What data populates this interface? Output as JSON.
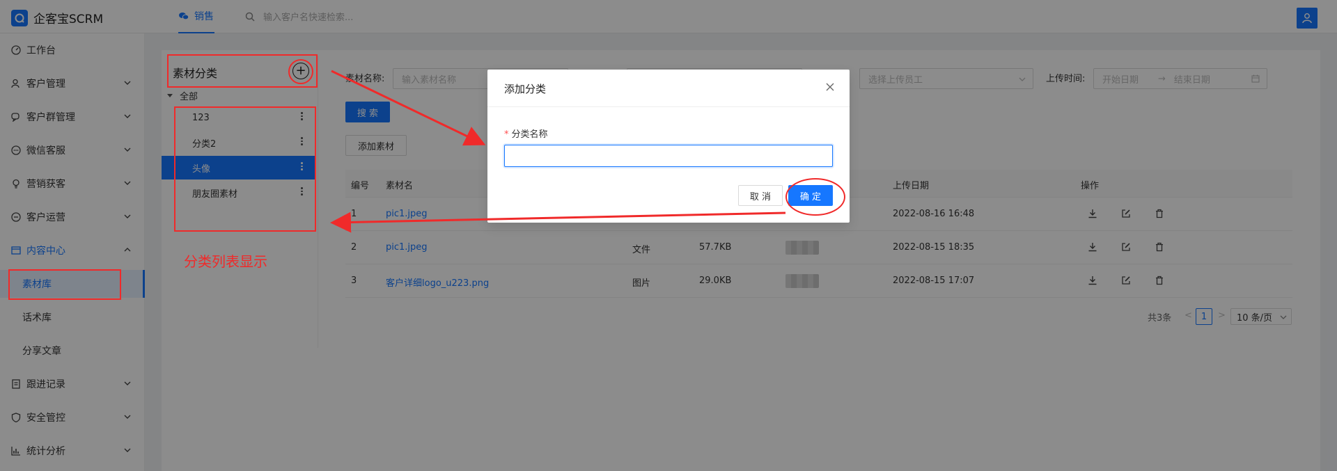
{
  "app": {
    "title": "企客宝SCRM"
  },
  "topbar": {
    "tab_label": "销售",
    "search_placeholder": "输入客户名快速检索..."
  },
  "sidebar": {
    "items": [
      {
        "label": "工作台",
        "icon": "dashboard-icon"
      },
      {
        "label": "客户管理",
        "icon": "user-icon"
      },
      {
        "label": "客户群管理",
        "icon": "group-chat-icon"
      },
      {
        "label": "微信客服",
        "icon": "chat-icon"
      },
      {
        "label": "营销获客",
        "icon": "bulb-icon"
      },
      {
        "label": "客户运营",
        "icon": "ops-icon"
      },
      {
        "label": "内容中心",
        "icon": "content-icon"
      },
      {
        "label": "跟进记录",
        "icon": "record-icon"
      },
      {
        "label": "安全管控",
        "icon": "shield-icon"
      },
      {
        "label": "统计分析",
        "icon": "chart-icon"
      }
    ],
    "sub_items": [
      {
        "label": "素材库"
      },
      {
        "label": "话术库"
      },
      {
        "label": "分享文章"
      }
    ]
  },
  "category": {
    "title": "素材分类",
    "add_symbol": "+",
    "root": "全部",
    "items": [
      {
        "label": "123"
      },
      {
        "label": "分类2"
      },
      {
        "label": "头像"
      },
      {
        "label": "朋友圈素材"
      }
    ]
  },
  "filters": {
    "name_label": "素材名称:",
    "name_placeholder": "输入素材名称",
    "uploader_label_suffix": ":",
    "uploader_placeholder": "选择上传员工",
    "time_label": "上传时间:",
    "start_placeholder": "开始日期",
    "arrow": "→",
    "end_placeholder": "结束日期",
    "search_button": "搜 索",
    "add_button": "添加素材"
  },
  "table": {
    "headers": {
      "no": "编号",
      "name": "素材名",
      "upload_date": "上传日期",
      "ops": "操作"
    },
    "rows": [
      {
        "no": "1",
        "name": "pic1.jpeg",
        "type": "",
        "size": "",
        "date": "2022-08-16 16:48"
      },
      {
        "no": "2",
        "name": "pic1.jpeg",
        "type": "文件",
        "size": "57.7KB",
        "date": "2022-08-15 18:35"
      },
      {
        "no": "3",
        "name": "客户详细logo_u223.png",
        "type": "图片",
        "size": "29.0KB",
        "date": "2022-08-15 17:07"
      }
    ]
  },
  "pagination": {
    "total": "共3条",
    "prev": "<",
    "page": "1",
    "next": ">",
    "page_size": "10 条/页"
  },
  "modal": {
    "title": "添加分类",
    "required_mark": "*",
    "field_label": "分类名称",
    "field_value": "",
    "cancel": "取 消",
    "ok": "确 定"
  },
  "annotation": {
    "text": "分类列表显示",
    "color": "#f02a2a"
  },
  "colors": {
    "primary": "#1677ff",
    "annotation": "#f02a2a"
  }
}
